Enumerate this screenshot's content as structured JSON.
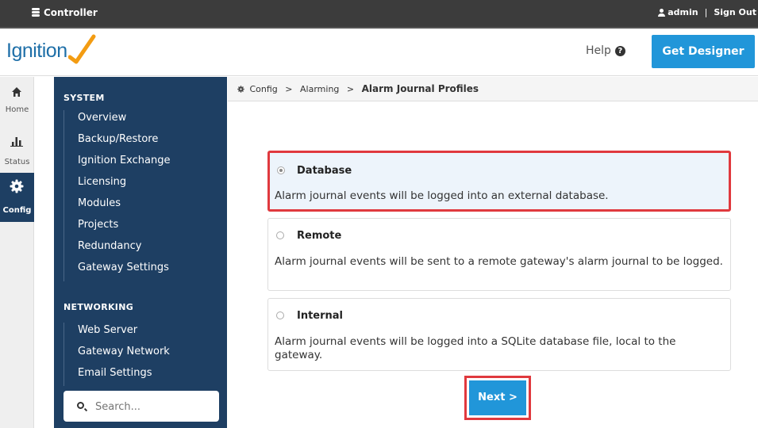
{
  "topbar": {
    "title": "Controller",
    "user": "admin",
    "separator": "|",
    "signout": "Sign Out"
  },
  "header": {
    "logo": "Ignition",
    "help": "Help",
    "designer_button": "Get Designer"
  },
  "rail": {
    "items": [
      {
        "label": "Home",
        "icon": "home-icon"
      },
      {
        "label": "Status",
        "icon": "bar-chart-icon"
      },
      {
        "label": "Config",
        "icon": "gear-icon",
        "active": true
      }
    ]
  },
  "nav": {
    "system_heading": "SYSTEM",
    "system_items": [
      "Overview",
      "Backup/Restore",
      "Ignition Exchange",
      "Licensing",
      "Modules",
      "Projects",
      "Redundancy",
      "Gateway Settings"
    ],
    "networking_heading": "NETWORKING",
    "networking_items": [
      "Web Server",
      "Gateway Network",
      "Email Settings"
    ],
    "search_placeholder": "Search..."
  },
  "breadcrumb": {
    "items": [
      "Config",
      "Alarming"
    ],
    "current": "Alarm Journal Profiles",
    "arrow": ">"
  },
  "options": [
    {
      "title": "Database",
      "description": "Alarm journal events will be logged into an external database.",
      "selected": true
    },
    {
      "title": "Remote",
      "description": "Alarm journal events will be sent to a remote gateway's alarm journal to be logged.",
      "selected": false
    },
    {
      "title": "Internal",
      "description": "Alarm journal events will be logged into a SQLite database file, local to the gateway.",
      "selected": false
    }
  ],
  "next_button": "Next >",
  "colors": {
    "nav_bg": "#1e3f63",
    "accent": "#2196d9",
    "highlight": "#e0393e"
  }
}
